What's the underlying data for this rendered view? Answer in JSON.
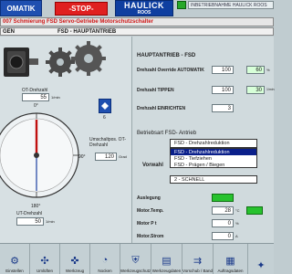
{
  "header": {
    "mode_label": "OMATIK",
    "stop_label": "-STOP-",
    "logo_line1": "HAULICK",
    "logo_line2": "ROOS",
    "status_text": "INBETRIEBNAHME HAULICK ROOS"
  },
  "message_bar": "007 Schmierung FSD Servo-Getriebe Motorschutzschalter",
  "title_bar": {
    "left": "GEN",
    "right": "FSD - HAUPTANTRIEB"
  },
  "right_panel": {
    "heading": "HAUPTANTRIEB - FSD",
    "rows": [
      {
        "label": "Drehzahl Override AUTOMATIK",
        "value": "100",
        "pct": "60",
        "pct_unit": "%"
      },
      {
        "label": "Drehzahl TIPPEN",
        "value": "100",
        "pct": "30",
        "pct_unit": "1/min"
      },
      {
        "label": "Drehzahl EINRICHTEN",
        "value": "3"
      }
    ],
    "betriebsart_label": "Betriebsart  FSD- Antrieb",
    "dropdown": {
      "current": "FSD - Drehzahlreduktion",
      "options": [
        "FSD - Drehzahlreduktion",
        "FSD - Tiefziehen",
        "FSD - Prägen / Biegen"
      ],
      "selected_index": 0
    },
    "vorwahl_label": "Vorwahl",
    "speed_select": "2 - SCHNELL",
    "motor_rows": [
      {
        "label": "Auslegung",
        "value": ""
      },
      {
        "label": "Motor.Temp.",
        "value": "28",
        "unit": "°C"
      },
      {
        "label": "Motor P t",
        "value": "0",
        "unit": "%"
      },
      {
        "label": "Motor.Strom",
        "value": "0",
        "unit": "A"
      }
    ]
  },
  "left_panel": {
    "ot_label": "OT-Drehzahl",
    "ot_value": "55",
    "ot_unit": "1/min",
    "angle_label": "Umschaltpos. OT-Drehzahl",
    "angle_value": "120",
    "angle_unit": "Grad",
    "dial_0": "0°",
    "dial_90": "90°",
    "dial_180": "180°",
    "ut_label": "UT-Drehzahl",
    "ut_value": "50",
    "ut_unit": "1/min",
    "small_btn_label": "6"
  },
  "toolbar": {
    "items": [
      {
        "label": "Einstellen",
        "icon": "settings-icon"
      },
      {
        "label": "Umlüften",
        "icon": "fan-icon"
      },
      {
        "label": "Werkzeug",
        "icon": "tool-icon"
      },
      {
        "label": "Nocken",
        "icon": "cam-icon"
      },
      {
        "label": "Werkzeugschutz",
        "icon": "shield-icon"
      },
      {
        "label": "Werkzeugdaten",
        "icon": "data-icon"
      },
      {
        "label": "Vorschub / Band",
        "icon": "feed-icon"
      },
      {
        "label": "Auftragsdaten",
        "icon": "order-icon"
      },
      {
        "label": "",
        "icon": "misc-icon"
      }
    ]
  },
  "colors": {
    "accent_blue": "#1f4fb0",
    "stop_red": "#e02020",
    "ok_green": "#27c22e"
  }
}
